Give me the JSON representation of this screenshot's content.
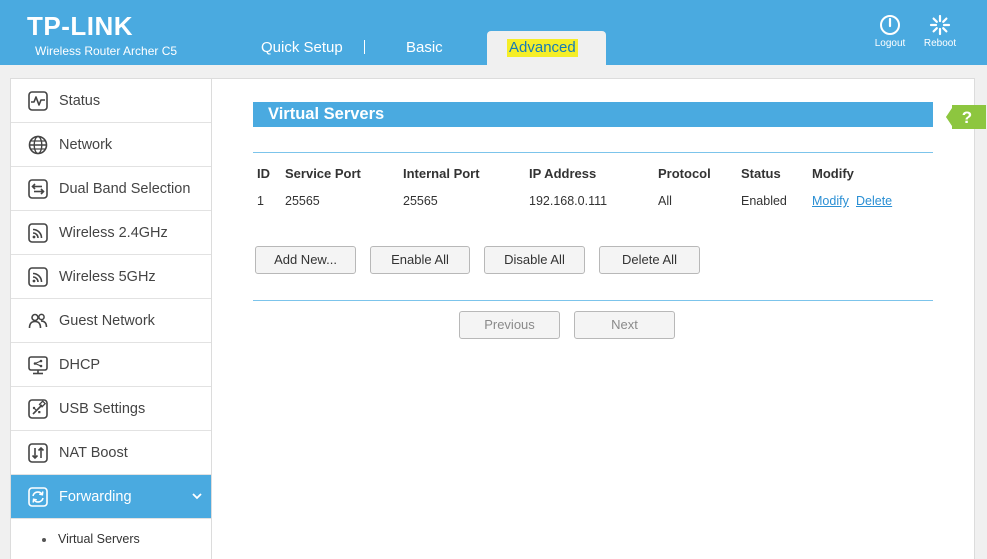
{
  "header": {
    "brand": "TP-LINK",
    "model": "Wireless Router Archer C5",
    "nav": [
      "Quick Setup",
      "Basic",
      "Advanced"
    ],
    "active_nav": "Advanced",
    "logout_label": "Logout",
    "reboot_label": "Reboot",
    "accent_color": "#4aaae0"
  },
  "sidebar": {
    "items": [
      {
        "label": "Status",
        "icon": "status-icon"
      },
      {
        "label": "Network",
        "icon": "globe-icon"
      },
      {
        "label": "Dual Band Selection",
        "icon": "dual-band-icon"
      },
      {
        "label": "Wireless 2.4GHz",
        "icon": "wireless-icon"
      },
      {
        "label": "Wireless 5GHz",
        "icon": "wireless-icon"
      },
      {
        "label": "Guest Network",
        "icon": "guest-icon"
      },
      {
        "label": "DHCP",
        "icon": "dhcp-icon"
      },
      {
        "label": "USB Settings",
        "icon": "usb-icon"
      },
      {
        "label": "NAT Boost",
        "icon": "nat-boost-icon"
      },
      {
        "label": "Forwarding",
        "icon": "forwarding-icon"
      }
    ],
    "active": "Forwarding",
    "sub_items": [
      "Virtual Servers"
    ]
  },
  "main": {
    "section_title": "Virtual Servers",
    "help_label": "?",
    "table": {
      "headers": [
        "ID",
        "Service Port",
        "Internal Port",
        "IP Address",
        "Protocol",
        "Status",
        "Modify"
      ],
      "rows": [
        {
          "id": "1",
          "service_port": "25565",
          "internal_port": "25565",
          "ip": "192.168.0.111",
          "protocol": "All",
          "status": "Enabled",
          "modify": "Modify",
          "delete": "Delete"
        }
      ]
    },
    "buttons": {
      "add_new": "Add New...",
      "enable_all": "Enable All",
      "disable_all": "Disable All",
      "delete_all": "Delete All",
      "previous": "Previous",
      "next": "Next"
    }
  }
}
